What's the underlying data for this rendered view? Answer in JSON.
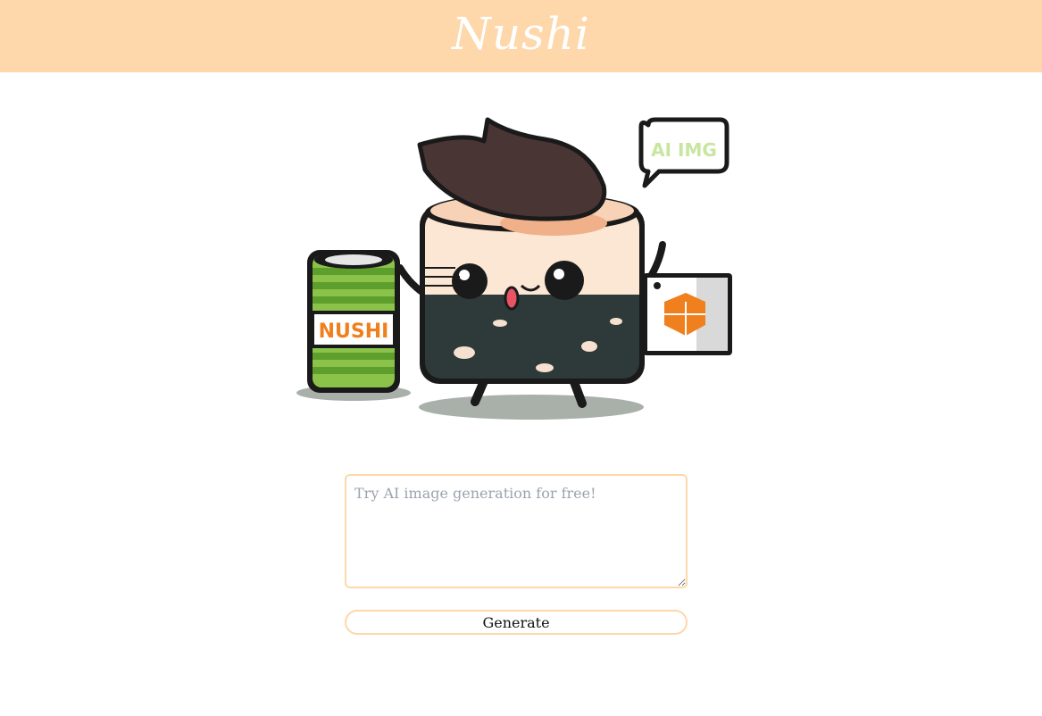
{
  "header": {
    "title": "Nushi"
  },
  "mascot": {
    "can_label": "NUSHI",
    "speech_bubble_text": "AI IMG",
    "colors": {
      "nori": "#2e3a3a",
      "rice": "#fce6d4",
      "hair": "#4a3535",
      "can_green": "#8bc34a",
      "accent_orange": "#f07f1e"
    }
  },
  "prompt": {
    "placeholder": "Try AI image generation for free!",
    "value": ""
  },
  "actions": {
    "generate_label": "Generate"
  },
  "theme": {
    "accent": "#fed7aa"
  }
}
